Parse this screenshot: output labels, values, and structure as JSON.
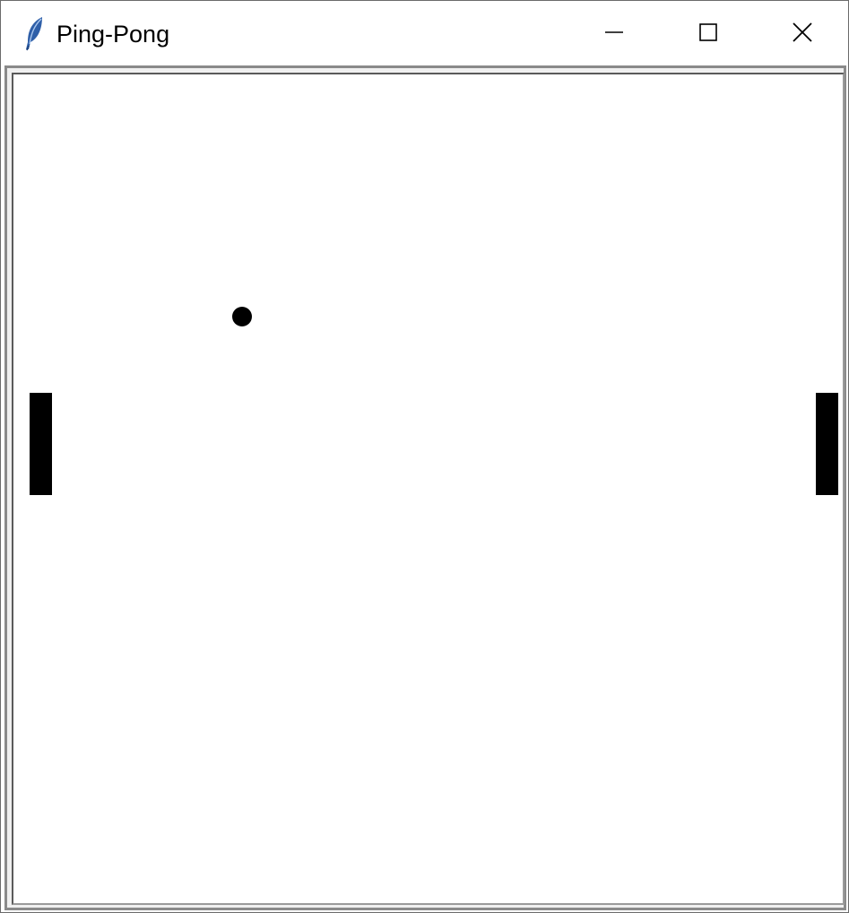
{
  "window": {
    "title": "Ping-Pong",
    "app_icon": "feather-icon"
  },
  "controls": {
    "minimize_icon": "minimize-icon",
    "maximize_icon": "maximize-icon",
    "close_icon": "close-icon"
  },
  "game": {
    "background_color": "#ffffff",
    "foreground_color": "#000000",
    "ball": "ball",
    "left_paddle": "left-paddle",
    "right_paddle": "right-paddle"
  }
}
